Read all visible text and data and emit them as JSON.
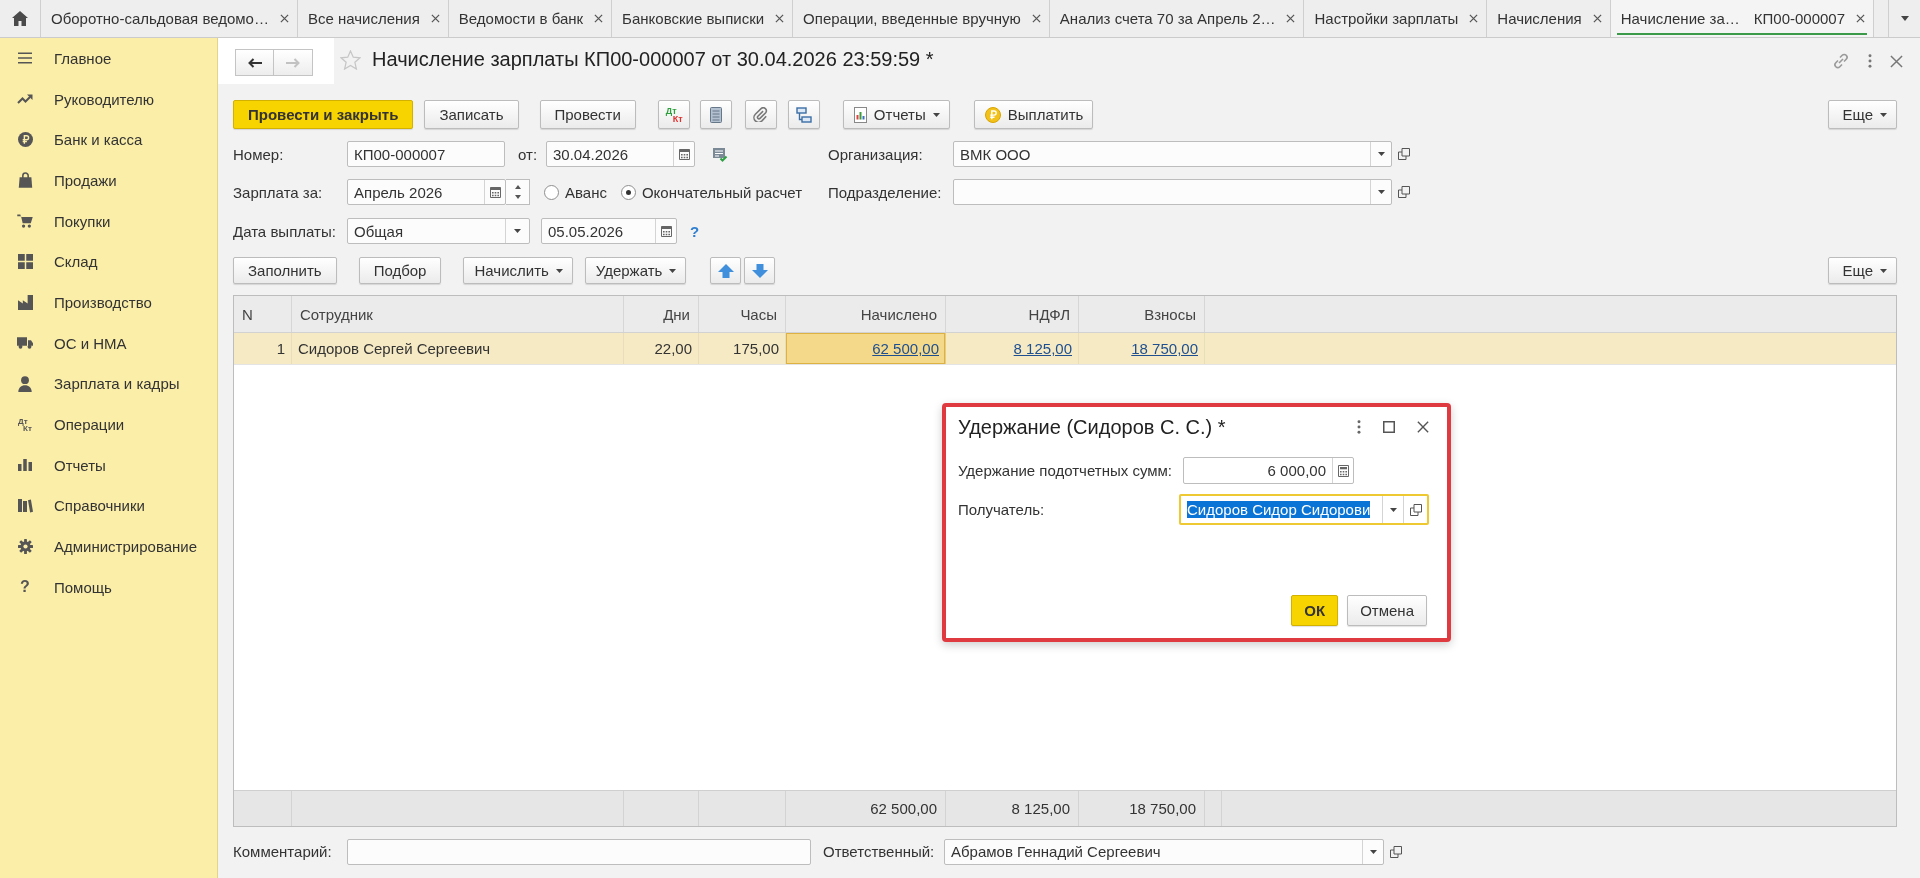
{
  "tabs": [
    {
      "label": "Оборотно-сальдовая ведомо…",
      "selected": false
    },
    {
      "label": "Все начисления",
      "selected": false
    },
    {
      "label": "Ведомости в банк",
      "selected": false
    },
    {
      "label": "Банковские выписки",
      "selected": false
    },
    {
      "label": "Операции, введенные вручную",
      "selected": false
    },
    {
      "label": "Анализ счета 70 за Апрель 2…",
      "selected": false
    },
    {
      "label": "Настройки зарплаты",
      "selected": false
    },
    {
      "label": "Начисления",
      "selected": false
    },
    {
      "label": "Начисление за…",
      "detail": "КП00-000007",
      "selected": true
    }
  ],
  "sidebar": {
    "items": [
      {
        "label": "Главное"
      },
      {
        "label": "Руководителю"
      },
      {
        "label": "Банк и касса"
      },
      {
        "label": "Продажи"
      },
      {
        "label": "Покупки"
      },
      {
        "label": "Склад"
      },
      {
        "label": "Производство"
      },
      {
        "label": "ОС и НМА"
      },
      {
        "label": "Зарплата и кадры"
      },
      {
        "label": "Операции",
        "icon_letters": [
          "Дт",
          "Кт"
        ]
      },
      {
        "label": "Отчеты"
      },
      {
        "label": "Справочники"
      },
      {
        "label": "Администрирование"
      },
      {
        "label": "Помощь",
        "icon_letters": [
          "?"
        ]
      }
    ]
  },
  "document": {
    "title": "Начисление зарплаты КП00-000007 от 30.04.2026 23:59:59 *",
    "back_disabled": false,
    "forward_disabled": true,
    "favorite": false,
    "toolbar": [
      {
        "kind": "primary",
        "label": "Провести и закрыть"
      },
      {
        "kind": "button",
        "label": "Записать"
      },
      {
        "kind": "button",
        "label": "Провести"
      },
      {
        "kind": "dtkt",
        "letters": [
          "Дт",
          "Кт"
        ]
      },
      {
        "kind": "ledger"
      },
      {
        "kind": "attach"
      },
      {
        "kind": "structure"
      },
      {
        "kind": "report",
        "label": "Отчеты"
      },
      {
        "kind": "coin",
        "label": "Выплатить"
      }
    ],
    "more": "Еще",
    "number": {
      "label": "Номер:",
      "value": "КП00-000007"
    },
    "date": {
      "label": "от:",
      "value": "30.04.2026"
    },
    "organization": {
      "label": "Организация:",
      "value": "ВМК ООО"
    },
    "period": {
      "label": "Зарплата за:",
      "value": "Апрель 2026"
    },
    "payment_type": [
      {
        "label": "Аванс",
        "selected": false
      },
      {
        "label": "Окончательный расчет",
        "selected": true
      }
    ],
    "department": {
      "label": "Подразделение:"
    },
    "payment_date": {
      "label": "Дата выплаты:",
      "value": "Общая",
      "date": "05.05.2026",
      "help": "?"
    },
    "table_toolbar": [
      {
        "kind": "button",
        "label": "Заполнить"
      },
      {
        "kind": "button",
        "label": "Подбор"
      },
      {
        "kind": "menu",
        "label": "Начислить"
      },
      {
        "kind": "menu",
        "label": "Удержать"
      },
      {
        "kind": "up"
      },
      {
        "kind": "down"
      }
    ],
    "table_more": "Еще",
    "table": {
      "columns": [
        {
          "label": "N"
        },
        {
          "label": "Сотрудник"
        },
        {
          "label": "Дни"
        },
        {
          "label": "Часы"
        },
        {
          "label": "Начислено",
          "total": "62 500,00"
        },
        {
          "label": "НДФЛ",
          "total": "8 125,00"
        },
        {
          "label": "Взносы",
          "total": "18 750,00"
        }
      ],
      "rows": [
        {
          "selected": true,
          "cells": [
            {
              "text": "1",
              "link": false,
              "current": false
            },
            {
              "text": "Сидоров Сергей Сергеевич",
              "link": false,
              "current": false
            },
            {
              "text": "22,00",
              "link": false,
              "current": false
            },
            {
              "text": "175,00",
              "link": false,
              "current": false
            },
            {
              "text": "62 500,00",
              "link": true,
              "current": true
            },
            {
              "text": "8 125,00",
              "link": true,
              "current": false
            },
            {
              "text": "18 750,00",
              "link": true,
              "current": false
            }
          ]
        }
      ]
    },
    "comment": {
      "label": "Комментарий:"
    },
    "responsible": {
      "label": "Ответственный:",
      "value": "Абрамов Геннадий Сергеевич"
    }
  },
  "dialog": {
    "title": "Удержание (Сидоров С. С.) *",
    "highlighted": true,
    "amount": {
      "label": "Удержание подотчетных сумм:",
      "value": "6 000,00"
    },
    "recipient": {
      "label": "Получатель:",
      "value": "Сидоров Сидор Сидорови",
      "focused": true,
      "text_selected": true
    },
    "buttons": [
      {
        "label": "ОК",
        "default": true
      },
      {
        "label": "Отмена",
        "default": false
      }
    ]
  }
}
